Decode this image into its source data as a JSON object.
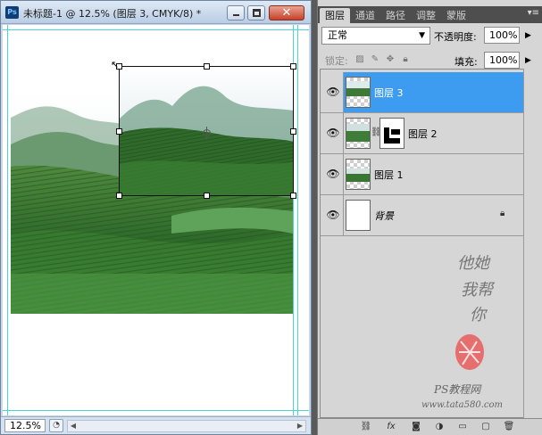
{
  "document": {
    "title": "未标题-1 @ 12.5% (图层 3, CMYK/8) *",
    "app_badge": "Ps",
    "zoom": "12.5%"
  },
  "panel": {
    "tabs": [
      "图层",
      "通道",
      "路径",
      "调整",
      "蒙版"
    ],
    "active_tab": "图层",
    "blend_mode": "正常",
    "opacity_label": "不透明度:",
    "opacity_value": "100%",
    "lock_label": "锁定:",
    "fill_label": "填充:",
    "fill_value": "100%",
    "layers": [
      {
        "name": "图层 3",
        "selected": true,
        "visible": true,
        "has_mask": false
      },
      {
        "name": "图层 2",
        "selected": false,
        "visible": true,
        "has_mask": true
      },
      {
        "name": "图层 1",
        "selected": false,
        "visible": true,
        "has_mask": false
      },
      {
        "name": "背景",
        "selected": false,
        "visible": true,
        "locked": true
      }
    ],
    "watermark": {
      "line1": "他她",
      "line2": "我帮",
      "line3": "你",
      "line4": "PS教程网",
      "line5": "www.tata580.com"
    }
  },
  "icons": {
    "eye": "visibility-eye-icon",
    "chain": "link-chain-icon",
    "lock": "lock-icon"
  }
}
